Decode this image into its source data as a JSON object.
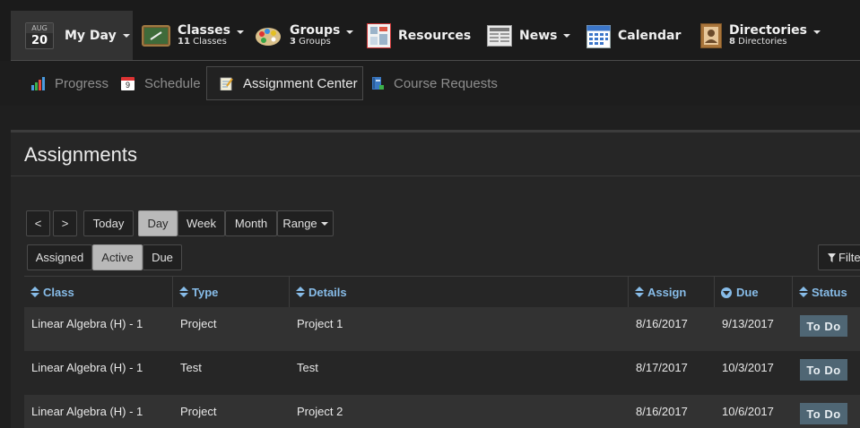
{
  "top_nav": {
    "my_day": {
      "month": "AUG",
      "day": "20",
      "label": "My Day"
    },
    "classes": {
      "label": "Classes",
      "count": "11",
      "sub": "Classes"
    },
    "groups": {
      "label": "Groups",
      "count": "3",
      "sub": "Groups"
    },
    "resources": {
      "label": "Resources"
    },
    "news": {
      "label": "News"
    },
    "calendar": {
      "label": "Calendar"
    },
    "directories": {
      "label": "Directories",
      "count": "8",
      "sub": "Directories"
    }
  },
  "sub_nav": {
    "items": [
      {
        "label": "Progress",
        "icon": "bar-chart-icon"
      },
      {
        "label": "Schedule",
        "icon": "calendar-day-icon",
        "icon_text": "9"
      },
      {
        "label": "Assignment Center",
        "icon": "notepad-icon",
        "active": true
      },
      {
        "label": "Course Requests",
        "icon": "book-icon"
      }
    ]
  },
  "panel": {
    "title": "Assignments",
    "date_controls": {
      "prev": "<",
      "next": ">",
      "today": "Today",
      "day": "Day",
      "week": "Week",
      "month": "Month",
      "range": "Range",
      "selected": "Day"
    },
    "status_filters": {
      "assigned": "Assigned",
      "active": "Active",
      "due": "Due",
      "selected": "Active"
    },
    "filter_label": "Filte"
  },
  "table": {
    "columns": [
      "Class",
      "Type",
      "Details",
      "Assign",
      "Due",
      "Status"
    ],
    "rows": [
      {
        "class": "Linear Algebra (H) - 1",
        "type": "Project",
        "details": "Project 1",
        "assign": "8/16/2017",
        "due": "9/13/2017",
        "status": "To Do"
      },
      {
        "class": "Linear Algebra (H) - 1",
        "type": "Test",
        "details": "Test",
        "assign": "8/17/2017",
        "due": "10/3/2017",
        "status": "To Do"
      },
      {
        "class": "Linear Algebra (H) - 1",
        "type": "Project",
        "details": "Project 2",
        "assign": "8/16/2017",
        "due": "10/6/2017",
        "status": "To Do"
      }
    ]
  },
  "colors": {
    "accent_header": "#87bce8",
    "status_badge": "#4f6674",
    "background": "#1f1f1f"
  }
}
